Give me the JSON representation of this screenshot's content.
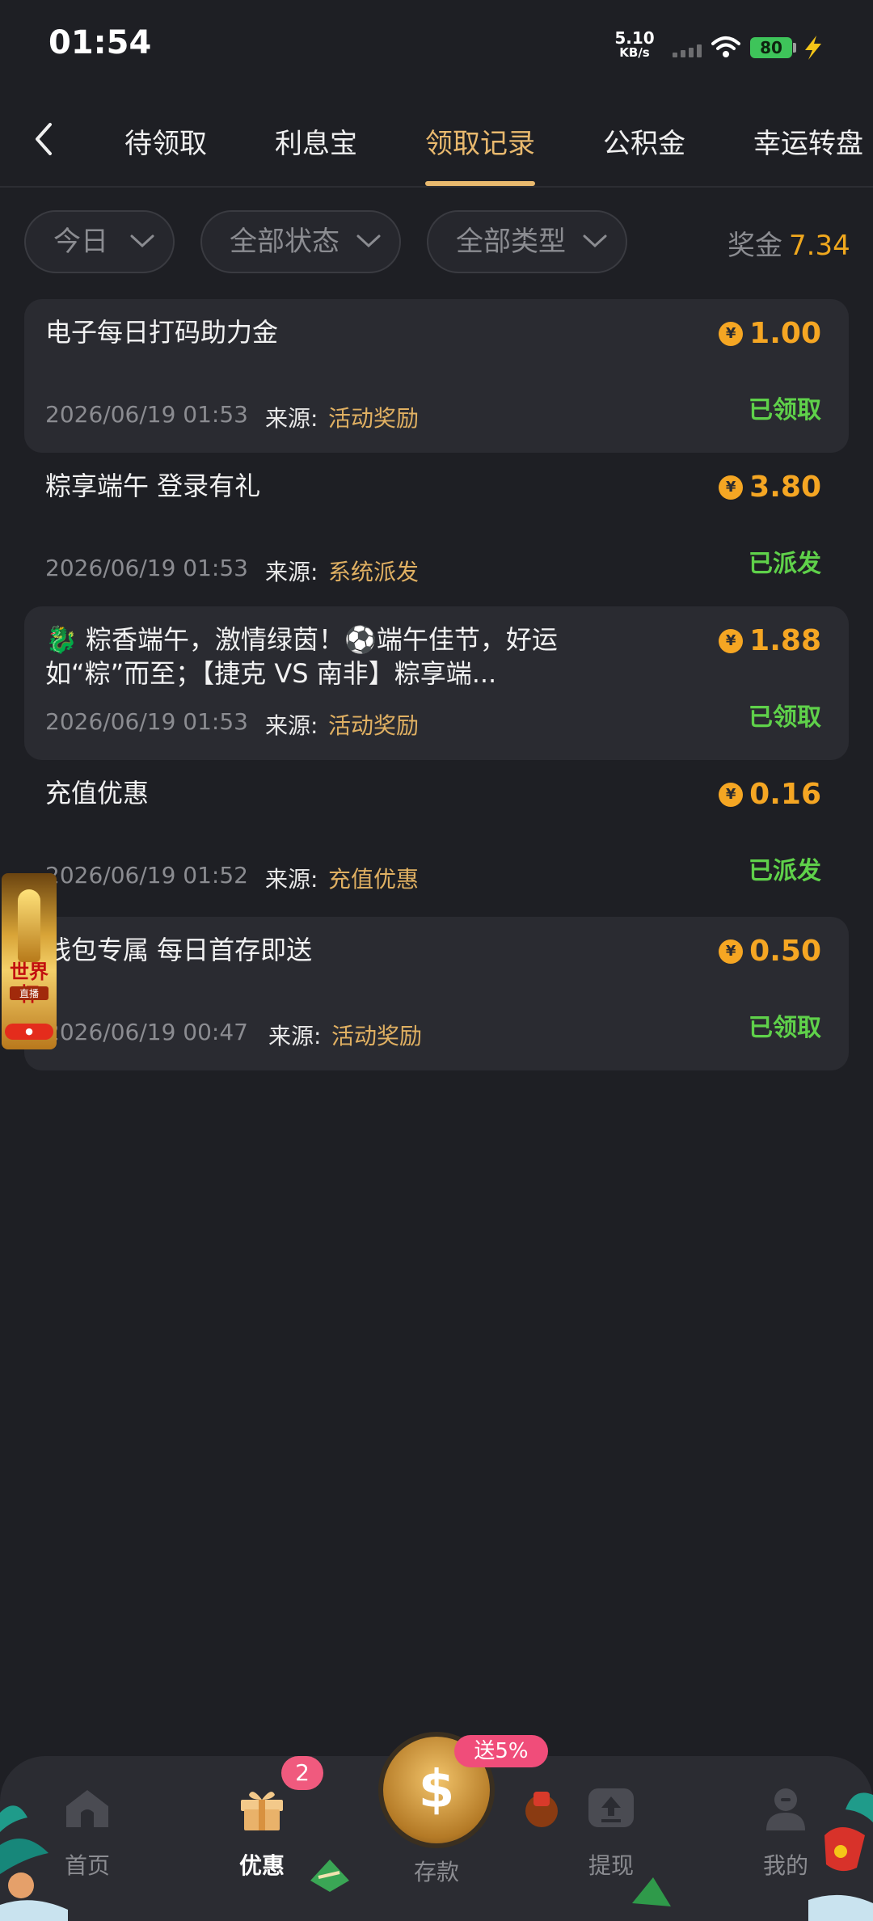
{
  "status": {
    "time": "01:54",
    "net_speed_value": "5.10",
    "net_speed_unit": "KB/s",
    "battery": "80"
  },
  "tabs": [
    {
      "label": "待领取"
    },
    {
      "label": "利息宝"
    },
    {
      "label": "领取记录"
    },
    {
      "label": "公积金"
    },
    {
      "label": "幸运转盘"
    }
  ],
  "filters": {
    "date": "今日",
    "status": "全部状态",
    "type": "全部类型"
  },
  "bonus": {
    "label": "奖金",
    "amount": "7.34"
  },
  "source_label": "来源:",
  "records": [
    {
      "title": "电子每日打码助力金",
      "amount": "1.00",
      "status": "已领取",
      "datetime": "2026/06/19 01:53",
      "source": "活动奖励"
    },
    {
      "title": "粽享端午 登录有礼",
      "amount": "3.80",
      "status": "已派发",
      "datetime": "2026/06/19 01:53",
      "source": "系统派发"
    },
    {
      "title": "🐉 粽香端午，激情绿茵！⚽端午佳节，好运如“粽”而至；【捷克 VS 南非】粽享端...",
      "amount": "1.88",
      "status": "已领取",
      "datetime": "2026/06/19 01:53",
      "source": "活动奖励"
    },
    {
      "title": "充值优惠",
      "amount": "0.16",
      "status": "已派发",
      "datetime": "2026/06/19 01:52",
      "source": "充值优惠"
    },
    {
      "title": "钱包专属 每日首存即送",
      "amount": "0.50",
      "status": "已领取",
      "datetime": "2026/06/19 00:47",
      "source": "活动奖励"
    }
  ],
  "float_banner": {
    "title": "世界杯",
    "subtitle": "直播"
  },
  "nav": {
    "home": "首页",
    "promo": "优惠",
    "promo_badge": "2",
    "deposit": "存款",
    "deposit_tag": "送5%",
    "withdraw": "提现",
    "mine": "我的"
  },
  "colors": {
    "background": "#1e1f24",
    "accent_gold": "#e9b96e",
    "amount_orange": "#f5a623",
    "status_green": "#5fd14a",
    "badge_pink": "#f05a7e"
  }
}
